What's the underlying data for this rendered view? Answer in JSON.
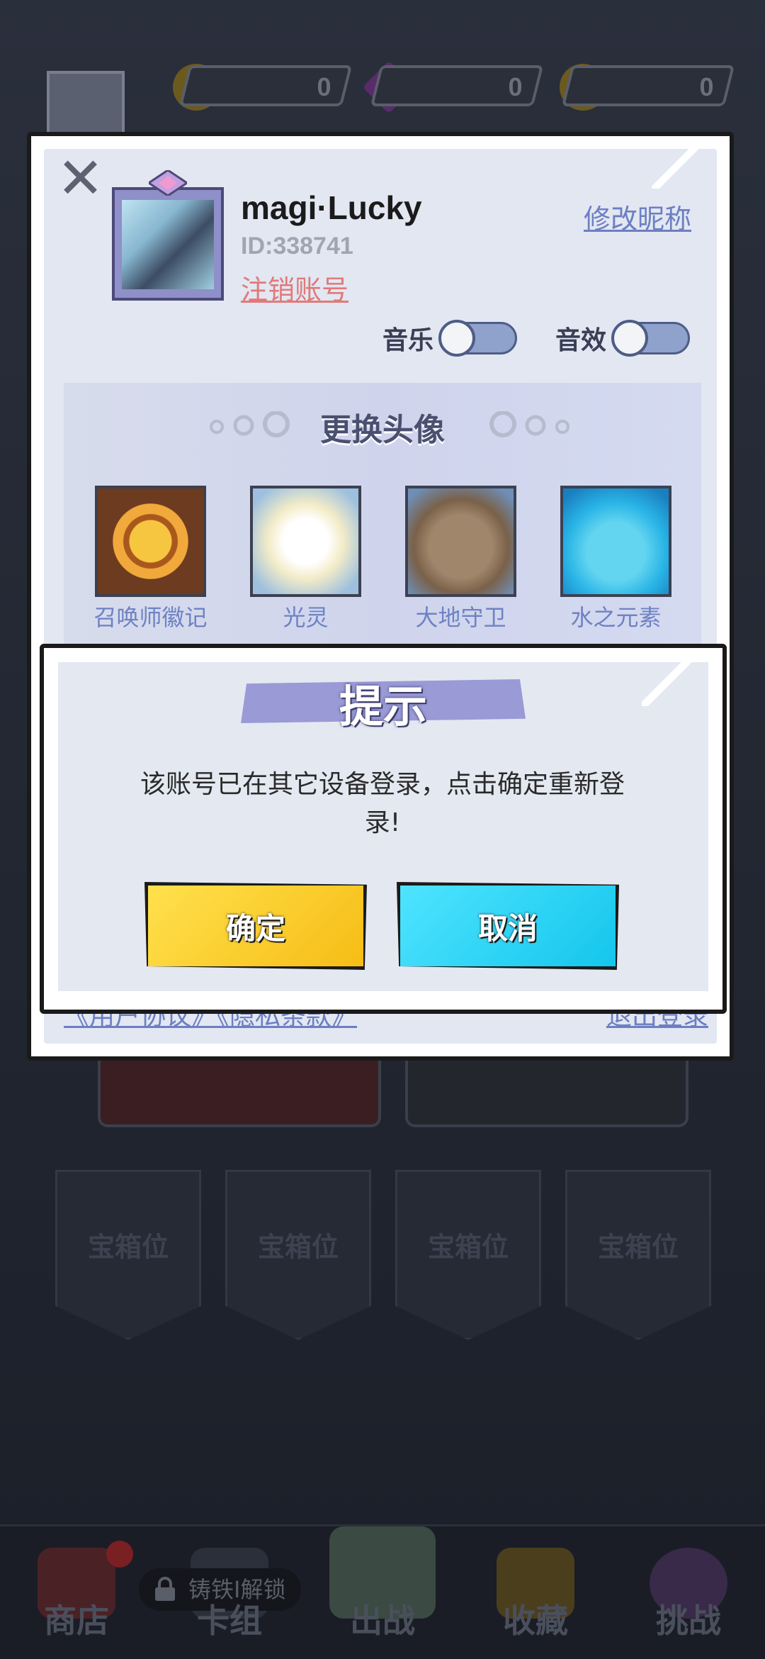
{
  "top_bar": {
    "gold": "0",
    "gems": "0",
    "stars": "0"
  },
  "profile": {
    "name": "magi·Lucky",
    "id": "ID:338741",
    "logout_label": "注销账号",
    "rename_label": "修改昵称",
    "music_label": "音乐",
    "sfx_label": "音效",
    "music_on": false,
    "sfx_on": false
  },
  "avatar_section": {
    "title": "更换头像",
    "options": [
      {
        "name": "召唤师徽记",
        "icon": "summoner-emblem"
      },
      {
        "name": "光灵",
        "icon": "light-spirit"
      },
      {
        "name": "大地守卫",
        "icon": "earth-guardian"
      },
      {
        "name": "水之元素",
        "icon": "water-elemental"
      }
    ]
  },
  "footer": {
    "links": "《用户协议》《隐私条款》",
    "exit": "退出登录"
  },
  "dialog": {
    "title": "提示",
    "message": "该账号已在其它设备登录，点击确定重新登录!",
    "confirm_label": "确定",
    "cancel_label": "取消"
  },
  "chest_slots": [
    "宝箱位",
    "宝箱位",
    "宝箱位",
    "宝箱位"
  ],
  "bottom_nav": {
    "items": [
      {
        "label": "商店",
        "icon": "shop-icon"
      },
      {
        "label": "卡组",
        "icon": "deck-icon"
      },
      {
        "label": "出战",
        "icon": "battle-icon"
      },
      {
        "label": "收藏",
        "icon": "collection-icon"
      },
      {
        "label": "挑战",
        "icon": "challenge-icon"
      }
    ],
    "lock_text": "铸铁I解锁"
  },
  "colors": {
    "link": "#6d7fc2",
    "danger_link": "#e07a7a",
    "confirm": "#f6bd15",
    "cancel": "#14c6ec",
    "banner": "#9a9ad6"
  }
}
